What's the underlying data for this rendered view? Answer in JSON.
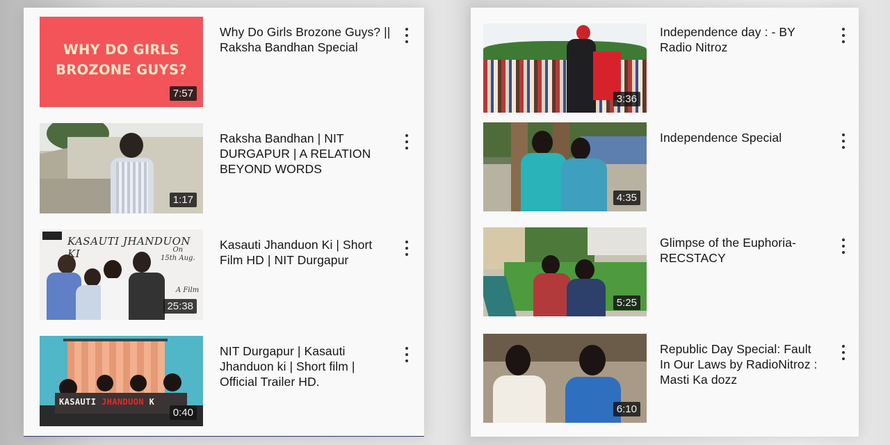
{
  "left_column": {
    "videos": [
      {
        "title": "Why Do Girls Brozone Guys? ||\nRaksha Bandhan Special",
        "duration": "7:57",
        "thumb_text": "WHY DO GIRLS\nBROZONE GUYS?"
      },
      {
        "title": "Raksha Bandhan | NIT\nDURGAPUR | A RELATION\nBEYOND WORDS",
        "duration": "1:17"
      },
      {
        "title": "Kasauti Jhanduon Ki | Short\nFilm HD | NIT Durgapur",
        "duration": "25:38",
        "thumb_text": "KASAUTI JHANDUON KI",
        "thumb_date": "On\n15th Aug.",
        "thumb_credit": "A Film"
      },
      {
        "title": "NIT Durgapur | Kasauti\nJhanduon ki | Short film |\nOfficial Trailer HD.",
        "duration": "0:40",
        "thumb_text_a": "KASAUTI ",
        "thumb_text_b": "JHANDUON",
        "thumb_text_c": " K"
      }
    ]
  },
  "right_column": {
    "videos": [
      {
        "title": "Independence day  : - BY\nRadio Nitroz",
        "duration": "3:36"
      },
      {
        "title": "Independence Special",
        "duration": "4:35"
      },
      {
        "title": "Glimpse of the Euphoria-\nRECSTACY",
        "duration": "5:25"
      },
      {
        "title": "Republic Day Special: Fault\nIn Our Laws by RadioNitroz :\nMasti Ka dozz",
        "duration": "6:10"
      }
    ]
  },
  "icons": {
    "menu": "more-vert-icon"
  },
  "colors": {
    "card_bg": "#f9f9f9",
    "thumb_red": "#f2545a",
    "thumb_text": "#fbe7c8",
    "duration_bg": "#141414"
  }
}
